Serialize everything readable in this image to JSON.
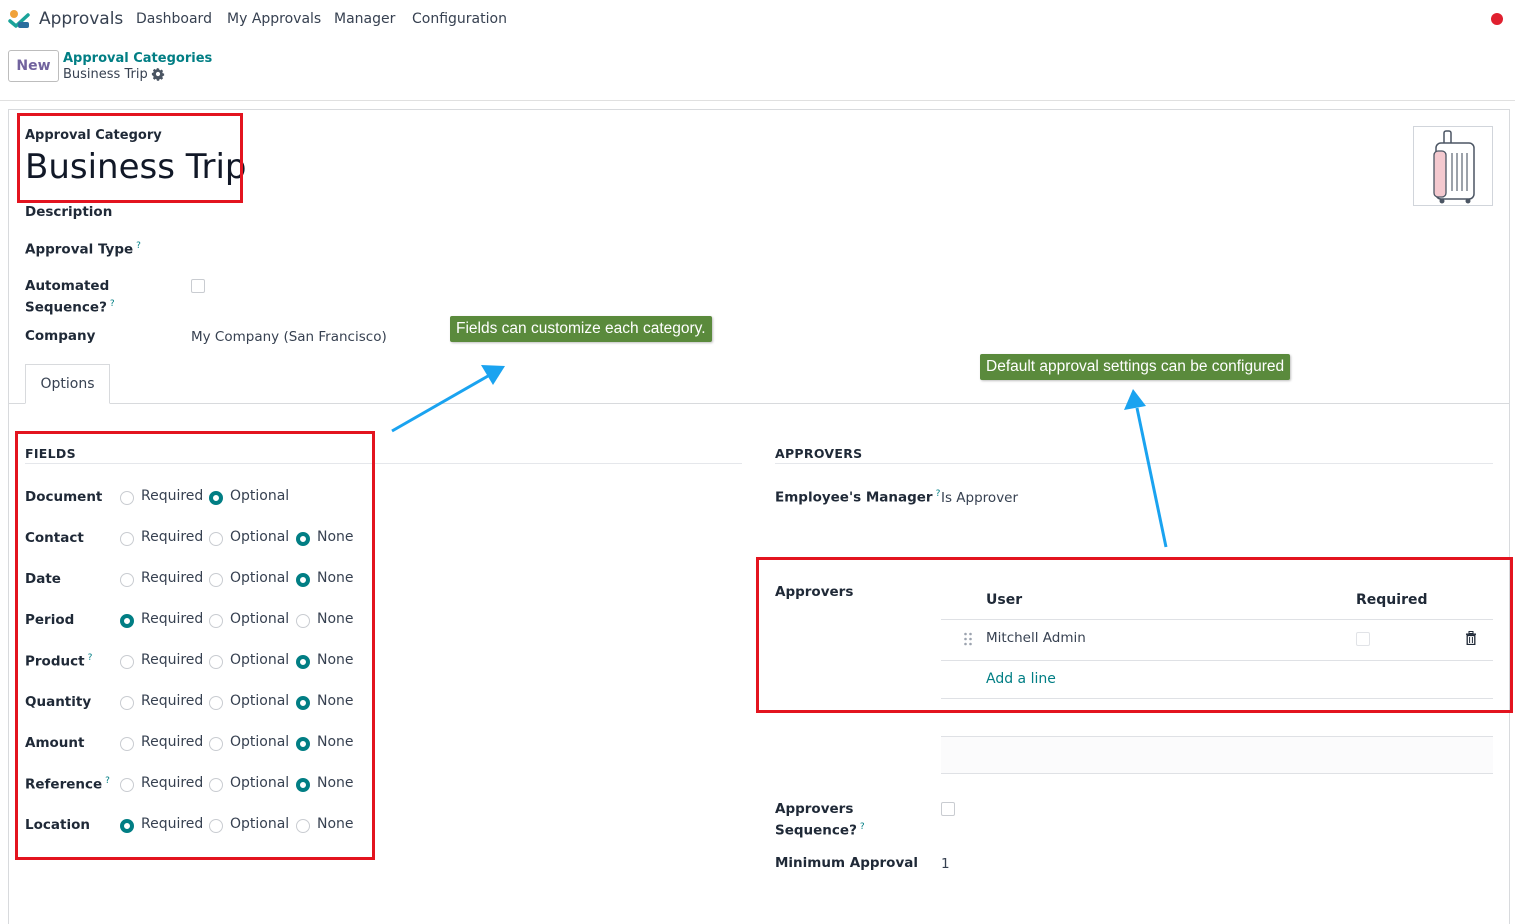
{
  "nav": {
    "app_name": "Approvals",
    "items": [
      "Dashboard",
      "My Approvals",
      "Manager",
      "Configuration"
    ]
  },
  "control_panel": {
    "new_label": "New",
    "breadcrumb_parent": "Approval Categories",
    "breadcrumb_current": "Business Trip"
  },
  "form": {
    "record_label": "Approval Category",
    "title": "Business Trip",
    "description_label": "Description",
    "approval_type_label": "Approval Type",
    "help_mark": "?",
    "automated_sequence_label_1": "Automated",
    "automated_sequence_label_2": "Sequence?",
    "company_label": "Company",
    "company_value": "My Company (San Francisco)",
    "tab_label": "Options"
  },
  "fields_section": {
    "title": "FIELDS",
    "option_labels": [
      "Required",
      "Optional",
      "None"
    ],
    "rows": [
      {
        "label": "Document",
        "help": false,
        "selected": "Optional",
        "has_none": false
      },
      {
        "label": "Contact",
        "help": false,
        "selected": "None",
        "has_none": true
      },
      {
        "label": "Date",
        "help": false,
        "selected": "None",
        "has_none": true
      },
      {
        "label": "Period",
        "help": false,
        "selected": "Required",
        "has_none": true
      },
      {
        "label": "Product",
        "help": true,
        "selected": "None",
        "has_none": true
      },
      {
        "label": "Quantity",
        "help": false,
        "selected": "None",
        "has_none": true
      },
      {
        "label": "Amount",
        "help": false,
        "selected": "None",
        "has_none": true
      },
      {
        "label": "Reference",
        "help": true,
        "selected": "None",
        "has_none": true
      },
      {
        "label": "Location",
        "help": false,
        "selected": "Required",
        "has_none": true
      }
    ]
  },
  "approvers_section": {
    "title": "APPROVERS",
    "manager_label": "Employee's Manager",
    "manager_value": "Is Approver",
    "approvers_label": "Approvers",
    "col_user": "User",
    "col_required": "Required",
    "approver_name": "Mitchell Admin",
    "add_line": "Add a line",
    "sequence_label_1": "Approvers",
    "sequence_label_2": "Sequence?",
    "min_approval_label": "Minimum Approval",
    "min_approval_value": "1"
  },
  "annotations": {
    "fields_tip": "Fields can customize each category.",
    "approvers_tip": "Default approval settings can be configured"
  },
  "colors": {
    "accent": "#017e84",
    "brand": "#71639e",
    "annotation_box": "#e3141f",
    "tooltip_bg": "#5a8a3c",
    "arrow": "#1aa3f0"
  }
}
